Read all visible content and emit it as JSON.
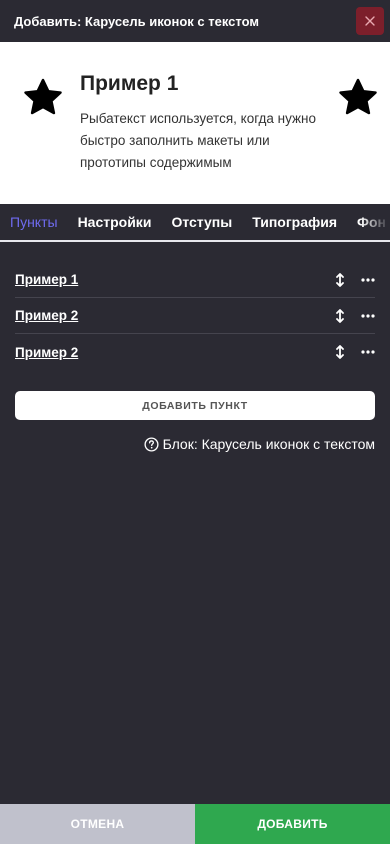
{
  "header": {
    "title": "Добавить: Карусель иконок с текстом",
    "close_icon": "close-icon",
    "close_color": "#7c1f2b"
  },
  "preview": {
    "title": "Пример 1",
    "text": "Рыбатекст используется, когда нужно быстро заполнить макеты или прототипы содержимым",
    "icon": "star-icon"
  },
  "tabs": [
    {
      "label": "Пункты",
      "active": true
    },
    {
      "label": "Настройки",
      "active": false
    },
    {
      "label": "Отступы",
      "active": false
    },
    {
      "label": "Типография",
      "active": false
    },
    {
      "label": "Фон",
      "active": false
    }
  ],
  "items": [
    {
      "label": "Пример 1"
    },
    {
      "label": "Пример 2"
    },
    {
      "label": "Пример 2"
    }
  ],
  "add_item_label": "ДОБАВИТЬ ПУНКТ",
  "block_info": "Блок: Карусель иконок с текстом",
  "footer": {
    "cancel_label": "ОТМЕНА",
    "submit_label": "ДОБАВИТЬ",
    "submit_color": "#2fa84f"
  },
  "colors": {
    "background": "#2b2a33",
    "accent": "#6f6bf0"
  }
}
